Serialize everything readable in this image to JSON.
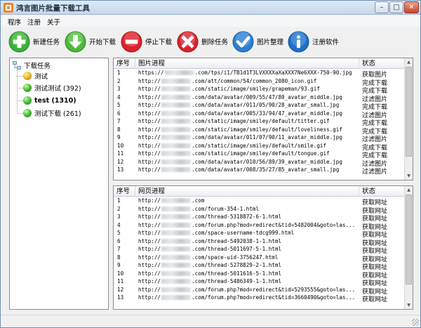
{
  "window": {
    "title": "鸿言图片批量下载工具"
  },
  "menu": [
    "程序",
    "注册",
    "关于"
  ],
  "toolbar": [
    {
      "label": "新建任务",
      "icon": "plus-icon",
      "color": "#3cae3c"
    },
    {
      "label": "开始下载",
      "icon": "arrow-down-icon",
      "color": "#4cb83a"
    },
    {
      "label": "停止下载",
      "icon": "stop-icon",
      "color": "#d9232e"
    },
    {
      "label": "删除任务",
      "icon": "delete-x-icon",
      "color": "#d9232e"
    },
    {
      "label": "图片整理",
      "icon": "check-icon",
      "color": "#2f7fd1"
    },
    {
      "label": "注册软件",
      "icon": "info-icon",
      "color": "#1f6fc4"
    }
  ],
  "tree": {
    "root": "下载任务",
    "items": [
      {
        "label": "测试",
        "state": "gold",
        "bold": false
      },
      {
        "label": "测试测试 (392)",
        "state": "green",
        "bold": false
      },
      {
        "label": "test (1310)",
        "state": "green",
        "bold": true
      },
      {
        "label": "测试下载 (261)",
        "state": "green",
        "bold": false
      }
    ]
  },
  "image_table": {
    "headers": [
      "序号",
      "图片进程",
      "状态"
    ],
    "rows": [
      {
        "no": "1",
        "pre": "https://",
        "post": ".com/tps/i1/TB1d1T3LVXXXXaXaXXX7Ne6XXX-750-90.jpg",
        "status": "获取图片"
      },
      {
        "no": "2",
        "pre": "http://",
        "post": ".com/att/common/54/common_2080_icon.gif",
        "status": "完成下载"
      },
      {
        "no": "3",
        "pre": "http://",
        "post": ".com/static/image/smiley/grapeman/93.gif",
        "status": "完成下载"
      },
      {
        "no": "4",
        "pre": "http://",
        "post": ".com/data/avatar/009/55/47/80_avatar_middle.jpg",
        "status": "过滤图片"
      },
      {
        "no": "5",
        "pre": "http://",
        "post": ".com/data/avatar/011/05/90/28_avatar_small.jpg",
        "status": "完成下载"
      },
      {
        "no": "6",
        "pre": "http://",
        "post": ".com/data/avatar/005/33/94/47_avatar_middle.jpg",
        "status": "过滤图片"
      },
      {
        "no": "7",
        "pre": "http://",
        "post": ".com/static/image/smiley/default/titter.gif",
        "status": "完成下载"
      },
      {
        "no": "8",
        "pre": "http://",
        "post": ".com/static/image/smiley/default/loveliness.gif",
        "status": "完成下载"
      },
      {
        "no": "9",
        "pre": "http://",
        "post": ".com/data/avatar/011/07/90/11_avatar_middle.jpg",
        "status": "过滤图片"
      },
      {
        "no": "10",
        "pre": "http://",
        "post": ".com/static/image/smiley/default/smile.gif",
        "status": "完成下载"
      },
      {
        "no": "11",
        "pre": "http://",
        "post": ".com/static/image/smiley/default/tongue.gif",
        "status": "完成下载"
      },
      {
        "no": "12",
        "pre": "http://",
        "post": ".com/data/avatar/010/56/89/39_avatar_middle.jpg",
        "status": "过滤图片"
      },
      {
        "no": "13",
        "pre": "http://",
        "post": ".com/data/avatar/008/35/27/85_avatar_small.jpg",
        "status": "过滤图片"
      }
    ]
  },
  "page_table": {
    "headers": [
      "序号",
      "网页进程",
      "状态"
    ],
    "rows": [
      {
        "no": "1",
        "pre": "http://",
        "post": ".com",
        "status": "获取网址"
      },
      {
        "no": "2",
        "pre": "http://",
        "post": ".com/forum-354-1.html",
        "status": "获取网址"
      },
      {
        "no": "3",
        "pre": "http://",
        "post": ".com/thread-5318872-6-1.html",
        "status": "获取网址"
      },
      {
        "no": "4",
        "pre": "http://",
        "post": ".com/forum.php?mod=redirect&tid=5482004&goto=las...",
        "status": "获取网址"
      },
      {
        "no": "5",
        "pre": "http://",
        "post": ".com/space-username-tdcg999.html",
        "status": "获取网址"
      },
      {
        "no": "6",
        "pre": "http://",
        "post": ".com/thread-5492038-1-1.html",
        "status": "获取网址"
      },
      {
        "no": "7",
        "pre": "http://",
        "post": ".com/thread-5011697-5-1.html",
        "status": "获取网址"
      },
      {
        "no": "8",
        "pre": "http://",
        "post": ".com/space-uid-3756247.html",
        "status": "获取网址"
      },
      {
        "no": "9",
        "pre": "http://",
        "post": ".com/thread-5278829-2-1.html",
        "status": "获取网址"
      },
      {
        "no": "10",
        "pre": "http://",
        "post": ".com/thread-5011616-5-1.html",
        "status": "获取网址"
      },
      {
        "no": "11",
        "pre": "http://",
        "post": ".com/thread-5486349-1-1.html",
        "status": "获取网址"
      },
      {
        "no": "12",
        "pre": "http://",
        "post": ".com/forum.php?mod=redirect&tid=5293555&goto=las...",
        "status": "获取网址"
      },
      {
        "no": "13",
        "pre": "http://",
        "post": ".com/forum.php?mod=redirect&tid=3660490&goto=las...",
        "status": "获取网址"
      }
    ]
  }
}
